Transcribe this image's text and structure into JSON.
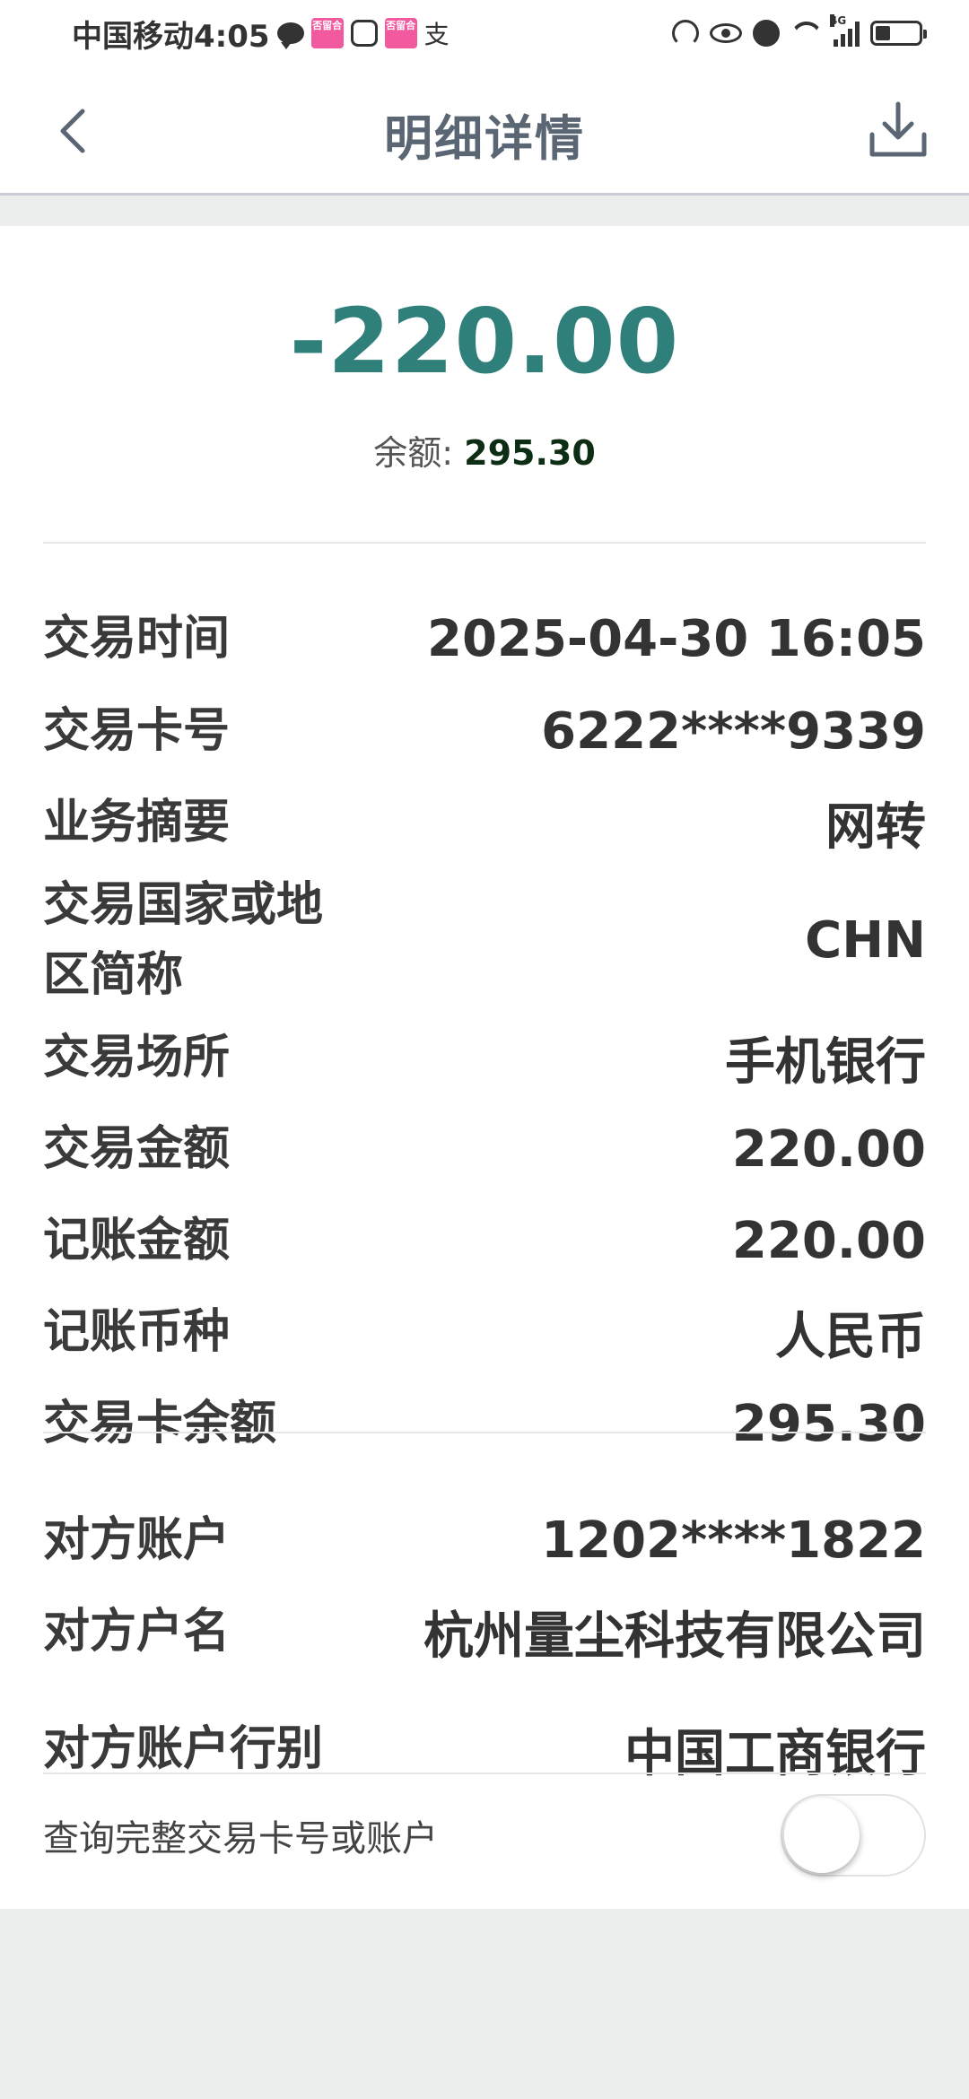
{
  "status_bar": {
    "carrier_time": "中国移动4:05",
    "pink_badge_text": "否留合",
    "pay_glyph": "支",
    "network": "4G",
    "battery_level": 0.35
  },
  "header": {
    "title": "明细详情"
  },
  "summary": {
    "amount": "-220.00",
    "balance_label": "余额: ",
    "balance_value": "295.30",
    "amount_color": "#2f7f7b"
  },
  "details": [
    {
      "label": "交易时间",
      "value": "2025-04-30 16:05"
    },
    {
      "label": "交易卡号",
      "value": "6222****9339"
    },
    {
      "label": "业务摘要",
      "value": "网转"
    },
    {
      "label": "交易国家或地区简称",
      "value": "CHN"
    },
    {
      "label": "交易场所",
      "value": "手机银行"
    },
    {
      "label": "交易金额",
      "value": "220.00"
    },
    {
      "label": "记账金额",
      "value": "220.00"
    },
    {
      "label": "记账币种",
      "value": "人民币"
    },
    {
      "label": "交易卡余额",
      "value": "295.30"
    }
  ],
  "counterparty": [
    {
      "label": "对方账户",
      "value": "1202****1822"
    },
    {
      "label": "对方户名",
      "value": "杭州量尘科技有限公司"
    },
    {
      "label": "对方账户行别",
      "value": "中国工商银行"
    }
  ],
  "toggle": {
    "label": "查询完整交易卡号或账户",
    "enabled": false
  }
}
